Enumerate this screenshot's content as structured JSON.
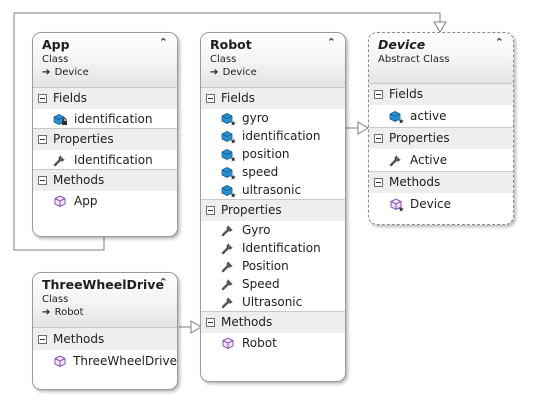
{
  "classes": {
    "app": {
      "name": "App",
      "kind": "Class",
      "base": "Device",
      "sections": {
        "fields": {
          "title": "Fields",
          "items": [
            "identification"
          ]
        },
        "properties": {
          "title": "Properties",
          "items": [
            "Identification"
          ]
        },
        "methods": {
          "title": "Methods",
          "items": [
            "App"
          ]
        }
      }
    },
    "robot": {
      "name": "Robot",
      "kind": "Class",
      "base": "Device",
      "sections": {
        "fields": {
          "title": "Fields",
          "items": [
            "gyro",
            "identification",
            "position",
            "speed",
            "ultrasonic"
          ]
        },
        "properties": {
          "title": "Properties",
          "items": [
            "Gyro",
            "Identification",
            "Position",
            "Speed",
            "Ultrasonic"
          ]
        },
        "methods": {
          "title": "Methods",
          "items": [
            "Robot"
          ]
        }
      }
    },
    "device": {
      "name": "Device",
      "kind": "Abstract Class",
      "sections": {
        "fields": {
          "title": "Fields",
          "items": [
            "active"
          ]
        },
        "properties": {
          "title": "Properties",
          "items": [
            "Active"
          ]
        },
        "methods": {
          "title": "Methods",
          "items": [
            "Device"
          ]
        }
      }
    },
    "threewheeldrive": {
      "name": "ThreeWheelDrive",
      "kind": "Class",
      "base": "Robot",
      "sections": {
        "methods": {
          "title": "Methods",
          "items": [
            "ThreeWheelDrive"
          ]
        }
      }
    }
  },
  "icons": {
    "field": "field-icon",
    "private_field": "private-field-icon",
    "property": "wrench-property-icon",
    "method": "method-cube-icon",
    "inherits": "inherits-arrow-icon",
    "collapse": "chevron-up-collapse-icon",
    "section_toggle": "minus-box-icon"
  },
  "colors": {
    "border": "#9a9a9a",
    "header_gradient_end": "#e4e4e4",
    "section_bg": "#eeeeee",
    "connector": "#7f7f7f",
    "field_icon": "#1f7fbf",
    "method_icon": "#8a4fb3"
  }
}
